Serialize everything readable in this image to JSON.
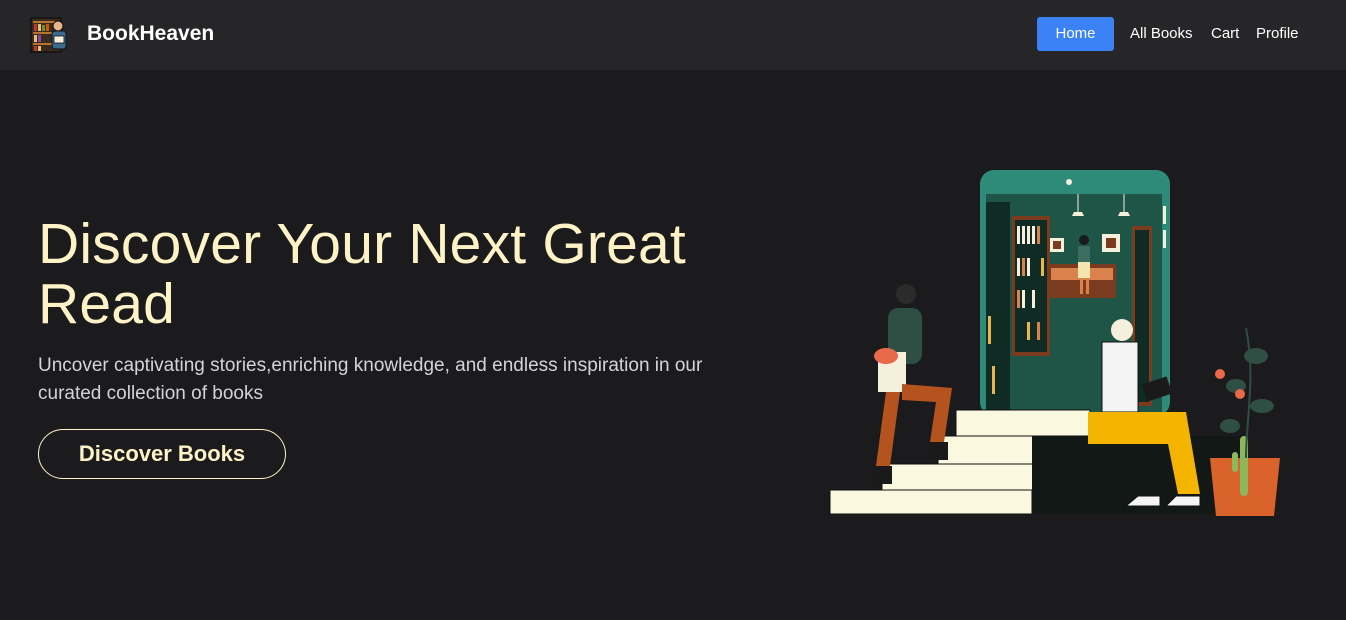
{
  "brand": {
    "name": "BookHeaven",
    "logo_icon": "bookshelf-logo-icon"
  },
  "nav": {
    "items": [
      {
        "label": "Home",
        "active": true
      },
      {
        "label": "All Books"
      },
      {
        "label": "Cart"
      },
      {
        "label": "Profile"
      }
    ],
    "active_color": "#3b82f6"
  },
  "hero": {
    "title": "Discover Your Next Great Read",
    "subtitle": "Uncover captivating stories,enriching knowledge, and endless inspiration in our curated collection of books",
    "button_label": "Discover Books",
    "illustration": "people-reading-phone-library-illustration"
  },
  "colors": {
    "background": "#1b1b1d",
    "navbar": "#262628",
    "accent_text": "#fef3c7"
  }
}
